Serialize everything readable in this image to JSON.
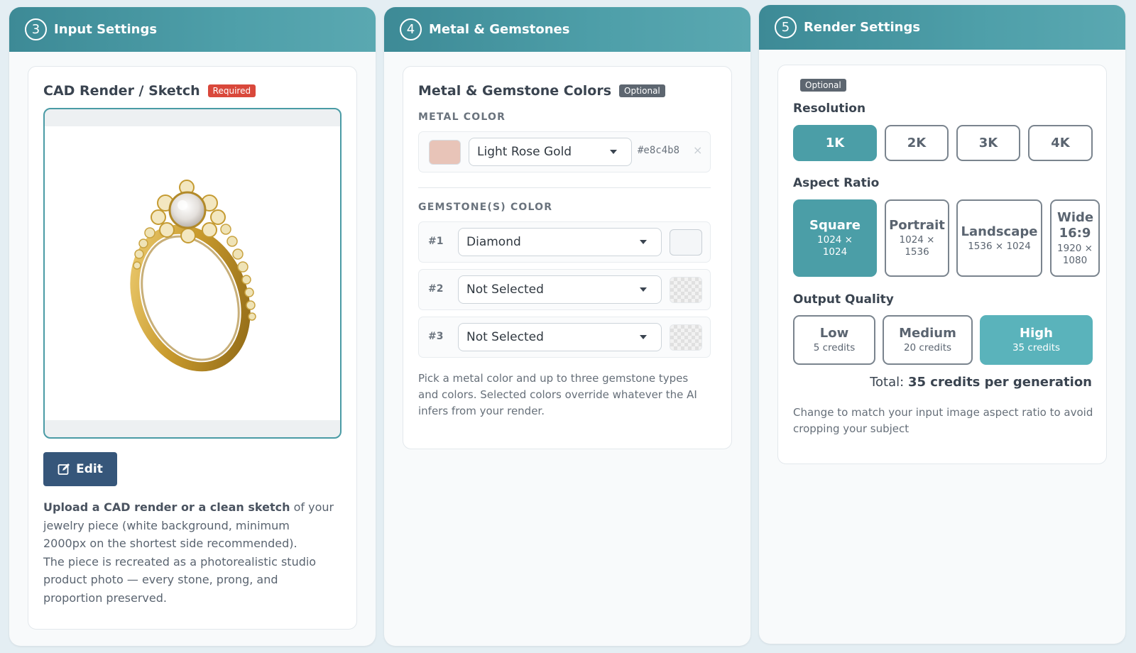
{
  "input_panel": {
    "step": "3",
    "title": "Input Settings",
    "card_title": "CAD Render / Sketch",
    "badge": "Required",
    "edit_label": "Edit",
    "desc_bold": "Upload a CAD render or a clean sketch",
    "desc_rest": " of your jewelry piece (white background, minimum 2000px on the shortest side recommended).",
    "desc_line2": "The piece is recreated as a photorealistic studio product photo — every stone, prong, and proportion preserved."
  },
  "metal_panel": {
    "step": "4",
    "title": "Metal & Gemstones",
    "card_title": "Metal & Gemstone Colors",
    "badge": "Optional",
    "metal_label": "METAL COLOR",
    "metal": {
      "value": "Light Rose Gold",
      "hex": "#e8c4b8",
      "swatch_color": "#e8c4b8"
    },
    "gem_label": "GEMSTONE(S) COLOR",
    "gems": [
      {
        "index": "#1",
        "value": "Diamond"
      },
      {
        "index": "#2",
        "value": "Not Selected"
      },
      {
        "index": "#3",
        "value": "Not Selected"
      }
    ],
    "help": "Pick a metal color and up to three gemstone types and colors. Selected colors override whatever the AI infers from your render."
  },
  "render_panel": {
    "step": "5",
    "title": "Render Settings",
    "badge": "Optional",
    "resolution_label": "Resolution",
    "resolutions": [
      "1K",
      "2K",
      "3K",
      "4K"
    ],
    "resolution_selected": "1K",
    "aspect_label": "Aspect Ratio",
    "aspects": [
      {
        "name": "Square",
        "dims": "1024 × 1024"
      },
      {
        "name": "Portrait",
        "dims": "1024 × 1536"
      },
      {
        "name": "Landscape",
        "dims": "1536 × 1024"
      },
      {
        "name": "Wide 16:9",
        "dims": "1920 × 1080"
      }
    ],
    "aspect_selected": "Square",
    "quality_label": "Output Quality",
    "qualities": [
      {
        "name": "Low",
        "credits": "5 credits"
      },
      {
        "name": "Medium",
        "credits": "20 credits"
      },
      {
        "name": "High",
        "credits": "35 credits"
      }
    ],
    "quality_selected": "High",
    "total_prefix": "Total:",
    "total_value": "35 credits per generation",
    "help": "Change to match your input image aspect ratio to avoid cropping your subject"
  },
  "colors": {
    "header": "#4693a0",
    "accent": "#4b9ea7",
    "required": "#d9483b",
    "edit_button": "#36567a"
  }
}
